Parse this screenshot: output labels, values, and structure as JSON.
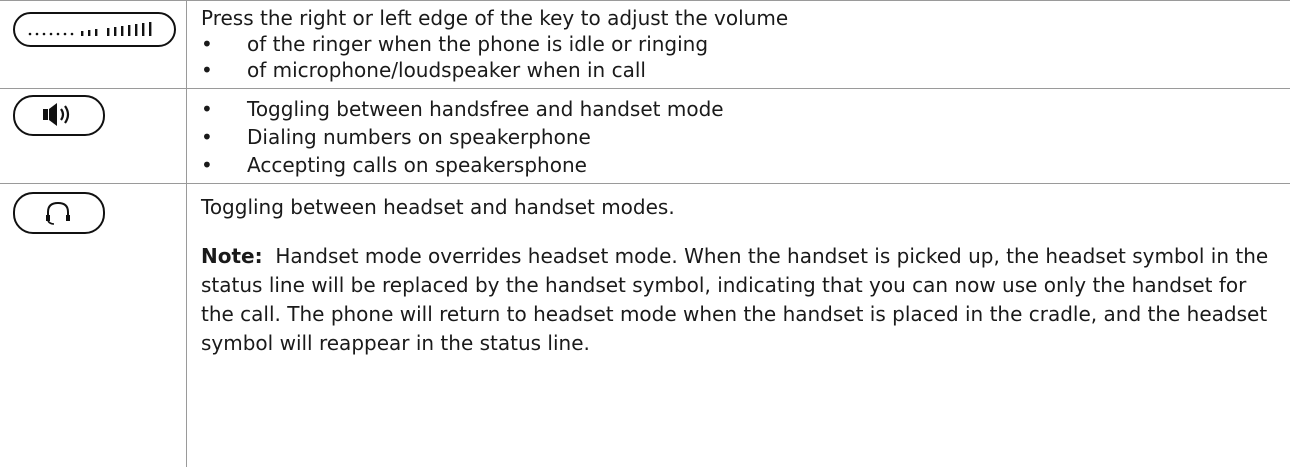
{
  "rows": [
    {
      "key_icon": "volume-rocker-icon",
      "intro": "Press the right or left edge of the key to adjust the volume",
      "bullets": [
        "of the ringer when the phone is idle or ringing",
        "of microphone/loudspeaker when in call"
      ]
    },
    {
      "key_icon": "speaker-icon",
      "bullets": [
        "Toggling between handsfree and handset mode",
        "Dialing numbers on speakerphone",
        "Accepting calls on speakersphone"
      ]
    },
    {
      "key_icon": "headset-icon",
      "intro": "Toggling between headset and handset modes.",
      "note_label": "Note:",
      "note_text": "Handset mode overrides headset mode.  When the handset is picked up, the headset symbol in the status line will be replaced by the handset symbol, indicating that you can now use only the handset for the call.  The phone will return to headset mode when the handset is placed in the cradle, and the headset symbol will reappear in the status line."
    }
  ],
  "bullet_char": "•"
}
